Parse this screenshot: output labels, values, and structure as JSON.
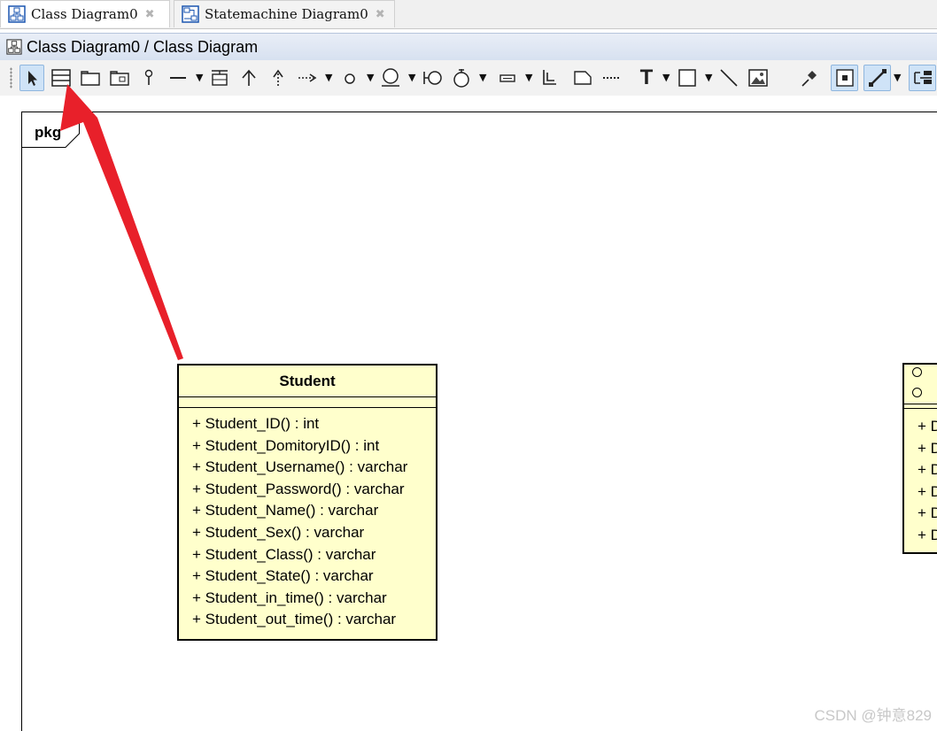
{
  "tabs": [
    {
      "label": "Class Diagram0",
      "icon": "class-diagram-icon",
      "active": true
    },
    {
      "label": "Statemachine Diagram0",
      "icon": "statemachine-diagram-icon",
      "active": false
    }
  ],
  "diagram_title": "Class Diagram0 / Class Diagram",
  "toolbar": {
    "tools": [
      "select-pointer-icon",
      "class-tool-icon",
      "package-tool-icon",
      "package-folder-tool-icon",
      "pin-tool-icon",
      "association-tool-icon",
      "class-split-tool-icon",
      "generalization-tool-icon",
      "realization-tool-icon",
      "dependency-tool-icon",
      "instance-circle-tool-icon",
      "interface-lollipop-tool-icon",
      "required-interface-tool-icon",
      "port-tool-icon",
      "slot-tool-icon",
      "corner-tool-icon",
      "note-tool-icon",
      "note-link-tool-icon",
      "text-tool-icon",
      "rectangle-tool-icon",
      "line-tool-icon",
      "image-tool-icon",
      "pin-stick-icon",
      "center-select-icon",
      "connector-style-icon",
      "align-icon"
    ],
    "text_tool_label": "T"
  },
  "package_label": "pkg",
  "classes": [
    {
      "name": "Student",
      "operations": [
        "+ Student_ID() : int",
        "+ Student_DomitoryID() : int",
        "+ Student_Username() : varchar",
        "+ Student_Password() : varchar",
        "+ Student_Name() : varchar",
        "+ Student_Sex() : varchar",
        "+ Student_Class() : varchar",
        "+ Student_State() : varchar",
        "+ Student_in_time() : varchar",
        "+ Student_out_time() : varchar"
      ]
    },
    {
      "name": "",
      "operations_prefix": [
        "+ D",
        "+ D",
        "+ D",
        "+ D",
        "+ D",
        "+ D"
      ]
    }
  ],
  "colors": {
    "class_fill": "#ffffcc",
    "annotation_arrow": "#e8202a",
    "selected_tool": "#cfe3f7"
  },
  "watermark": "CSDN @钟意829"
}
